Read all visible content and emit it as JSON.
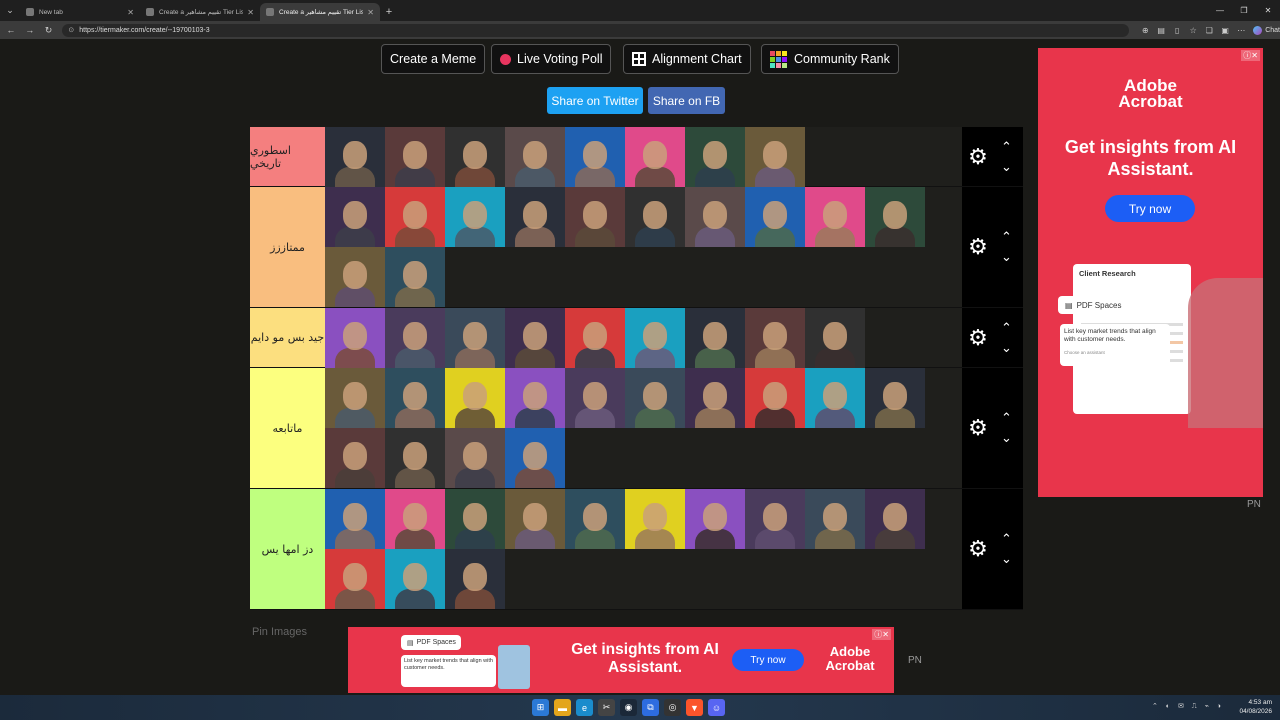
{
  "browser": {
    "tabs": [
      {
        "title": "New tab",
        "active": false
      },
      {
        "title": "Create a تقييم مشاهير Tier List - Tie",
        "active": false
      },
      {
        "title": "Create a تقييم مشاهير Tier List - Ti",
        "active": true
      }
    ],
    "url": "https://tiermaker.com/create/--19700103-3",
    "chat_label": "Chat"
  },
  "toolbar": {
    "meme": "Create a Meme",
    "poll": "Live Voting Poll",
    "alignment": "Alignment Chart",
    "rank": "Community Rank",
    "twitter": "Share on Twitter",
    "fb": "Share on FB"
  },
  "colors": {
    "tier_s": "#f47f7f",
    "tier_a": "#f9be7f",
    "tier_b": "#fcdf7f",
    "tier_c": "#fcff7f",
    "tier_d": "#bfff7f",
    "twitter": "#1da1f2",
    "fb": "#4267b2",
    "ad_bg": "#e8354b"
  },
  "tiers": [
    {
      "label": "اسطوري تاريخي",
      "color": "#f47f7f",
      "count": 8
    },
    {
      "label": "ممتاززز",
      "color": "#f9be7f",
      "count": 12
    },
    {
      "label": "جيد بس مو دايم",
      "color": "#fcdf7f",
      "count": 9
    },
    {
      "label": "ماتابعه",
      "color": "#fcff7f",
      "count": 14
    },
    {
      "label": "دز امها يس",
      "color": "#bfff7f",
      "count": 13
    }
  ],
  "ad_side": {
    "brand_line1": "Adobe",
    "brand_line2": "Acrobat",
    "headline": "Get insights from AI Assistant.",
    "cta": "Try now",
    "card_title": "Client Research",
    "chip": "PDF Spaces",
    "prompt": "List key market trends that align with customer needs.",
    "assistant": "Choose an assistant"
  },
  "ad_bottom": {
    "chip": "PDF Spaces",
    "prompt": "List key market trends that align with customer needs.",
    "headline": "Get insights from AI Assistant.",
    "cta": "Try now",
    "brand_line1": "Adobe",
    "brand_line2": "Acrobat"
  },
  "pn_label": "PN",
  "pin_images": "Pin Images",
  "clock": {
    "time": "4:53 am",
    "date": "04/08/2026"
  }
}
